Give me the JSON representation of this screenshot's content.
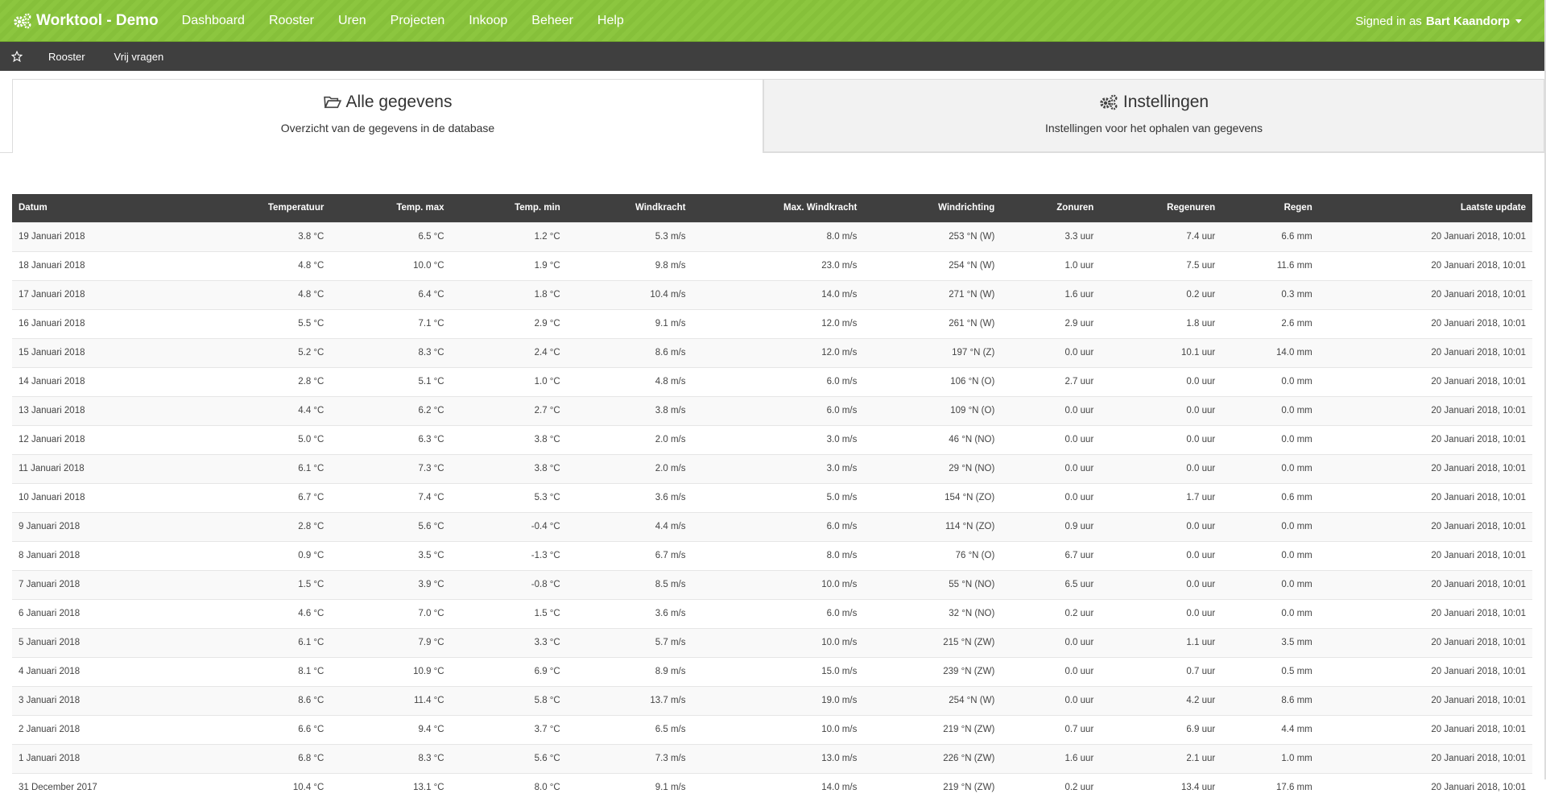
{
  "app": {
    "brand": "Worktool - Demo"
  },
  "nav": [
    {
      "label": "Dashboard"
    },
    {
      "label": "Rooster"
    },
    {
      "label": "Uren"
    },
    {
      "label": "Projecten"
    },
    {
      "label": "Inkoop"
    },
    {
      "label": "Beheer"
    },
    {
      "label": "Help"
    }
  ],
  "user": {
    "prefix": "Signed in as",
    "name": "Bart Kaandorp"
  },
  "subnav": [
    {
      "label": "Rooster"
    },
    {
      "label": "Vrij vragen"
    }
  ],
  "tabs": [
    {
      "title": "Alle gegevens",
      "description": "Overzicht van de gegevens in de database"
    },
    {
      "title": "Instellingen",
      "description": "Instellingen voor het ophalen van gegevens"
    }
  ],
  "table": {
    "columns": [
      "Datum",
      "Temperatuur",
      "Temp. max",
      "Temp. min",
      "Windkracht",
      "Max. Windkracht",
      "Windrichting",
      "Zonuren",
      "Regenuren",
      "Regen",
      "Laatste update"
    ],
    "rows": [
      [
        "19 Januari 2018",
        "3.8 °C",
        "6.5 °C",
        "1.2 °C",
        "5.3 m/s",
        "8.0 m/s",
        "253 °N (W)",
        "3.3 uur",
        "7.4 uur",
        "6.6 mm",
        "20 Januari 2018, 10:01"
      ],
      [
        "18 Januari 2018",
        "4.8 °C",
        "10.0 °C",
        "1.9 °C",
        "9.8 m/s",
        "23.0 m/s",
        "254 °N (W)",
        "1.0 uur",
        "7.5 uur",
        "11.6 mm",
        "20 Januari 2018, 10:01"
      ],
      [
        "17 Januari 2018",
        "4.8 °C",
        "6.4 °C",
        "1.8 °C",
        "10.4 m/s",
        "14.0 m/s",
        "271 °N (W)",
        "1.6 uur",
        "0.2 uur",
        "0.3 mm",
        "20 Januari 2018, 10:01"
      ],
      [
        "16 Januari 2018",
        "5.5 °C",
        "7.1 °C",
        "2.9 °C",
        "9.1 m/s",
        "12.0 m/s",
        "261 °N (W)",
        "2.9 uur",
        "1.8 uur",
        "2.6 mm",
        "20 Januari 2018, 10:01"
      ],
      [
        "15 Januari 2018",
        "5.2 °C",
        "8.3 °C",
        "2.4 °C",
        "8.6 m/s",
        "12.0 m/s",
        "197 °N (Z)",
        "0.0 uur",
        "10.1 uur",
        "14.0 mm",
        "20 Januari 2018, 10:01"
      ],
      [
        "14 Januari 2018",
        "2.8 °C",
        "5.1 °C",
        "1.0 °C",
        "4.8 m/s",
        "6.0 m/s",
        "106 °N (O)",
        "2.7 uur",
        "0.0 uur",
        "0.0 mm",
        "20 Januari 2018, 10:01"
      ],
      [
        "13 Januari 2018",
        "4.4 °C",
        "6.2 °C",
        "2.7 °C",
        "3.8 m/s",
        "6.0 m/s",
        "109 °N (O)",
        "0.0 uur",
        "0.0 uur",
        "0.0 mm",
        "20 Januari 2018, 10:01"
      ],
      [
        "12 Januari 2018",
        "5.0 °C",
        "6.3 °C",
        "3.8 °C",
        "2.0 m/s",
        "3.0 m/s",
        "46 °N (NO)",
        "0.0 uur",
        "0.0 uur",
        "0.0 mm",
        "20 Januari 2018, 10:01"
      ],
      [
        "11 Januari 2018",
        "6.1 °C",
        "7.3 °C",
        "3.8 °C",
        "2.0 m/s",
        "3.0 m/s",
        "29 °N (NO)",
        "0.0 uur",
        "0.0 uur",
        "0.0 mm",
        "20 Januari 2018, 10:01"
      ],
      [
        "10 Januari 2018",
        "6.7 °C",
        "7.4 °C",
        "5.3 °C",
        "3.6 m/s",
        "5.0 m/s",
        "154 °N (ZO)",
        "0.0 uur",
        "1.7 uur",
        "0.6 mm",
        "20 Januari 2018, 10:01"
      ],
      [
        "9 Januari 2018",
        "2.8 °C",
        "5.6 °C",
        "-0.4 °C",
        "4.4 m/s",
        "6.0 m/s",
        "114 °N (ZO)",
        "0.9 uur",
        "0.0 uur",
        "0.0 mm",
        "20 Januari 2018, 10:01"
      ],
      [
        "8 Januari 2018",
        "0.9 °C",
        "3.5 °C",
        "-1.3 °C",
        "6.7 m/s",
        "8.0 m/s",
        "76 °N (O)",
        "6.7 uur",
        "0.0 uur",
        "0.0 mm",
        "20 Januari 2018, 10:01"
      ],
      [
        "7 Januari 2018",
        "1.5 °C",
        "3.9 °C",
        "-0.8 °C",
        "8.5 m/s",
        "10.0 m/s",
        "55 °N (NO)",
        "6.5 uur",
        "0.0 uur",
        "0.0 mm",
        "20 Januari 2018, 10:01"
      ],
      [
        "6 Januari 2018",
        "4.6 °C",
        "7.0 °C",
        "1.5 °C",
        "3.6 m/s",
        "6.0 m/s",
        "32 °N (NO)",
        "0.2 uur",
        "0.0 uur",
        "0.0 mm",
        "20 Januari 2018, 10:01"
      ],
      [
        "5 Januari 2018",
        "6.1 °C",
        "7.9 °C",
        "3.3 °C",
        "5.7 m/s",
        "10.0 m/s",
        "215 °N (ZW)",
        "0.0 uur",
        "1.1 uur",
        "3.5 mm",
        "20 Januari 2018, 10:01"
      ],
      [
        "4 Januari 2018",
        "8.1 °C",
        "10.9 °C",
        "6.9 °C",
        "8.9 m/s",
        "15.0 m/s",
        "239 °N (ZW)",
        "0.0 uur",
        "0.7 uur",
        "0.5 mm",
        "20 Januari 2018, 10:01"
      ],
      [
        "3 Januari 2018",
        "8.6 °C",
        "11.4 °C",
        "5.8 °C",
        "13.7 m/s",
        "19.0 m/s",
        "254 °N (W)",
        "0.0 uur",
        "4.2 uur",
        "8.6 mm",
        "20 Januari 2018, 10:01"
      ],
      [
        "2 Januari 2018",
        "6.6 °C",
        "9.4 °C",
        "3.7 °C",
        "6.5 m/s",
        "10.0 m/s",
        "219 °N (ZW)",
        "0.7 uur",
        "6.9 uur",
        "4.4 mm",
        "20 Januari 2018, 10:01"
      ],
      [
        "1 Januari 2018",
        "6.8 °C",
        "8.3 °C",
        "5.6 °C",
        "7.3 m/s",
        "13.0 m/s",
        "226 °N (ZW)",
        "1.6 uur",
        "2.1 uur",
        "1.0 mm",
        "20 Januari 2018, 10:01"
      ],
      [
        "31 December 2017",
        "10.4 °C",
        "13.1 °C",
        "8.0 °C",
        "9.1 m/s",
        "14.0 m/s",
        "219 °N (ZW)",
        "0.2 uur",
        "13.4 uur",
        "17.6 mm",
        "20 Januari 2018, 10:01"
      ]
    ]
  }
}
